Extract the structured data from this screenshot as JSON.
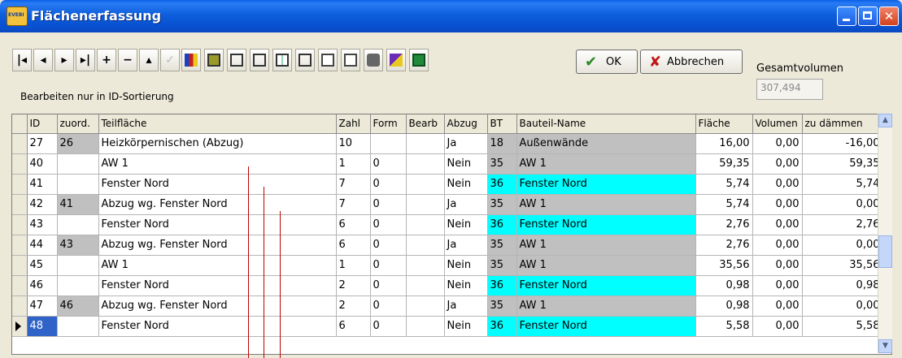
{
  "window": {
    "title": "Flächenerfassung"
  },
  "toolbar": {
    "nav_buttons": [
      "|◀",
      "◀",
      "▶",
      "▶|",
      "+",
      "−",
      "▲",
      "✓"
    ],
    "icon_names": [
      "report-icon",
      "hatch-icon",
      "eraser-icon",
      "field-icon",
      "columns-icon",
      "edit-icon",
      "calculator-icon",
      "save-icon",
      "camera-icon",
      "wand-icon",
      "excel-icon"
    ]
  },
  "buttons": {
    "ok": "OK",
    "cancel": "Abbrechen"
  },
  "gesamtvolumen": {
    "label": "Gesamtvolumen",
    "value": "307,494"
  },
  "hint": "Bearbeiten nur in ID-Sortierung",
  "table": {
    "columns": [
      "ID",
      "zuord.",
      "Teilfläche",
      "Zahl",
      "Form",
      "Bearb",
      "Abzug",
      "BT",
      "Bauteil-Name",
      "Fläche",
      "Volumen",
      "zu dämmen"
    ],
    "rows": [
      {
        "id": "27",
        "zuord": "26",
        "teil": "Heizkörpernischen (Abzug)",
        "zahl": "10",
        "form": "",
        "bearb": "",
        "abzug": "Ja",
        "bt": "18",
        "bauteil": "Außenwände",
        "flaeche": "16,00",
        "volumen": "0,00",
        "daemmen": "-16,00",
        "bt_color": "gray"
      },
      {
        "id": "40",
        "zuord": "",
        "teil": "AW 1",
        "zahl": "1",
        "form": "0",
        "bearb": "",
        "abzug": "Nein",
        "bt": "35",
        "bauteil": "AW 1",
        "flaeche": "59,35",
        "volumen": "0,00",
        "daemmen": "59,35",
        "bt_color": "gray"
      },
      {
        "id": "41",
        "zuord": "",
        "teil": "Fenster Nord",
        "zahl": "7",
        "form": "0",
        "bearb": "",
        "abzug": "Nein",
        "bt": "36",
        "bauteil": "Fenster Nord",
        "flaeche": "5,74",
        "volumen": "0,00",
        "daemmen": "5,74",
        "bt_color": "cyan"
      },
      {
        "id": "42",
        "zuord": "41",
        "teil": "Abzug wg. Fenster Nord",
        "zahl": "7",
        "form": "0",
        "bearb": "",
        "abzug": "Ja",
        "bt": "35",
        "bauteil": "AW 1",
        "flaeche": "5,74",
        "volumen": "0,00",
        "daemmen": "0,00",
        "bt_color": "gray"
      },
      {
        "id": "43",
        "zuord": "",
        "teil": "Fenster Nord",
        "zahl": "6",
        "form": "0",
        "bearb": "",
        "abzug": "Nein",
        "bt": "36",
        "bauteil": "Fenster Nord",
        "flaeche": "2,76",
        "volumen": "0,00",
        "daemmen": "2,76",
        "bt_color": "cyan"
      },
      {
        "id": "44",
        "zuord": "43",
        "teil": "Abzug wg. Fenster Nord",
        "zahl": "6",
        "form": "0",
        "bearb": "",
        "abzug": "Ja",
        "bt": "35",
        "bauteil": "AW 1",
        "flaeche": "2,76",
        "volumen": "0,00",
        "daemmen": "0,00",
        "bt_color": "gray"
      },
      {
        "id": "45",
        "zuord": "",
        "teil": "AW 1",
        "zahl": "1",
        "form": "0",
        "bearb": "",
        "abzug": "Nein",
        "bt": "35",
        "bauteil": "AW 1",
        "flaeche": "35,56",
        "volumen": "0,00",
        "daemmen": "35,56",
        "bt_color": "gray"
      },
      {
        "id": "46",
        "zuord": "",
        "teil": "Fenster Nord",
        "zahl": "2",
        "form": "0",
        "bearb": "",
        "abzug": "Nein",
        "bt": "36",
        "bauteil": "Fenster Nord",
        "flaeche": "0,98",
        "volumen": "0,00",
        "daemmen": "0,98",
        "bt_color": "cyan"
      },
      {
        "id": "47",
        "zuord": "46",
        "teil": "Abzug wg. Fenster Nord",
        "zahl": "2",
        "form": "0",
        "bearb": "",
        "abzug": "Ja",
        "bt": "35",
        "bauteil": "AW 1",
        "flaeche": "0,98",
        "volumen": "0,00",
        "daemmen": "0,00",
        "bt_color": "gray"
      },
      {
        "id": "48",
        "zuord": "",
        "teil": "Fenster Nord",
        "zahl": "6",
        "form": "0",
        "bearb": "",
        "abzug": "Nein",
        "bt": "36",
        "bauteil": "Fenster Nord",
        "flaeche": "5,58",
        "volumen": "0,00",
        "daemmen": "5,58",
        "bt_color": "cyan",
        "current": true
      }
    ]
  }
}
